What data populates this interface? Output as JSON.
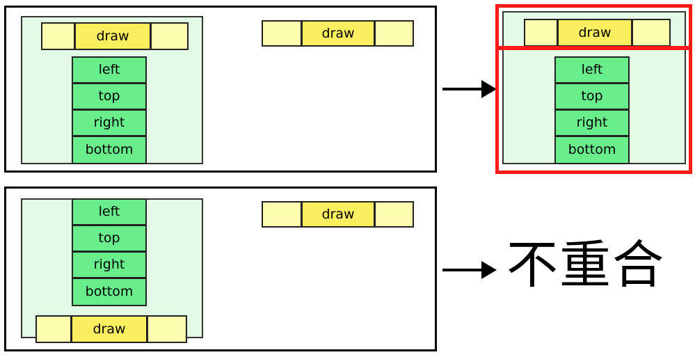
{
  "diagram": {
    "title_text_cjk": "不重合",
    "colors": {
      "panel_border": "#000000",
      "container_fill": "#e2fae6",
      "container_border": "#333333",
      "green_cell_fill": "#69ee8c",
      "green_cell_border": "#222222",
      "yellow_pale_fill": "#fdfdb0",
      "yellow_strong_fill": "#fbef60",
      "yellow_border": "#222222",
      "highlight_red": "#ff1a1a",
      "arrow_color": "#000000",
      "page_background": "#ffffff"
    },
    "labels": {
      "draw": "draw",
      "left": "left",
      "top": "top",
      "right": "right",
      "bottom": "bottom"
    },
    "rows": {
      "top_row": {
        "name": "case-overlapping",
        "before_panel": {
          "draw_row_position": "top",
          "draw_cells": [
            "",
            "draw",
            ""
          ],
          "stack_cells": [
            "left",
            "top",
            "right",
            "bottom"
          ]
        },
        "standalone_draw_row": {
          "cells": [
            "",
            "draw",
            ""
          ]
        },
        "arrow": "arrow-right",
        "after_panel": {
          "highlighted": true,
          "draw_cells": [
            "",
            "draw",
            ""
          ],
          "stack_cells": [
            "left",
            "top",
            "right",
            "bottom"
          ]
        }
      },
      "bottom_row": {
        "name": "case-not-overlapping",
        "before_panel": {
          "draw_row_position": "bottom",
          "stack_cells": [
            "left",
            "top",
            "right",
            "bottom"
          ],
          "draw_cells": [
            "",
            "draw",
            ""
          ]
        },
        "standalone_draw_row": {
          "cells": [
            "",
            "draw",
            ""
          ]
        },
        "arrow": "arrow-right",
        "result_text": "不重合"
      }
    }
  }
}
